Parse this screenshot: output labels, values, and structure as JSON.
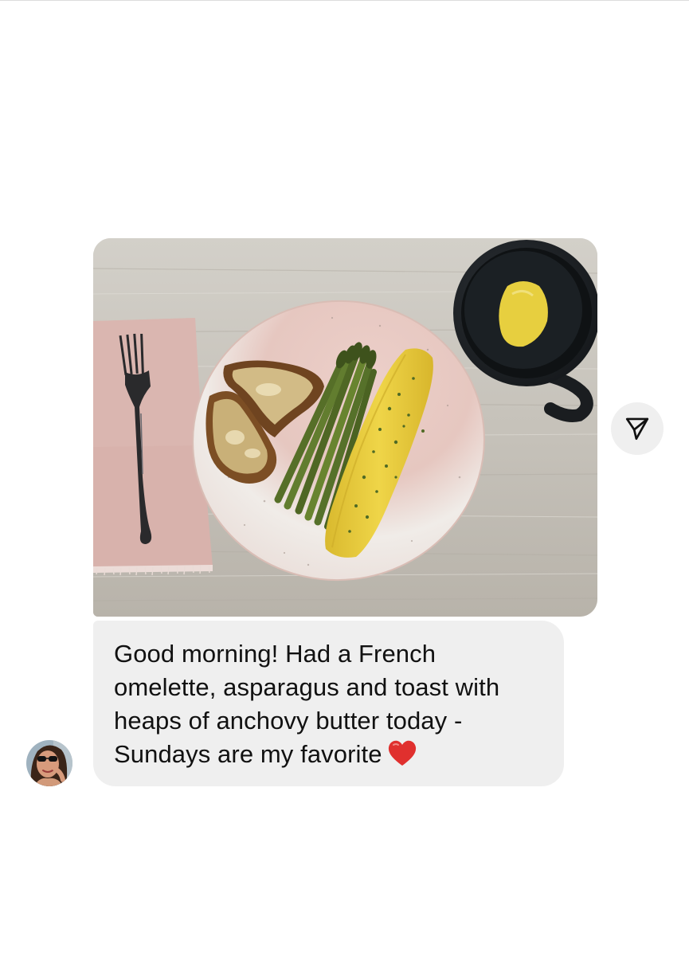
{
  "conversation": {
    "photo": {
      "alt": "Breakfast plate photo",
      "palette": {
        "table": "#c8c4bc",
        "napkin": "#d9b3ae",
        "plate_pink": "#e9c9c3",
        "plate_white": "#f1efec",
        "omelette": "#e5c93a",
        "asparagus": "#5f7a2e",
        "toast": "#8b5a2b",
        "mug": "#1f2327",
        "lemon": "#e8d34a"
      }
    },
    "share": {
      "icon": "send-icon"
    },
    "message": {
      "text": "Good morning! Had a French\nomelette, asparagus and toast with\nheaps of anchovy butter today -\nSundays are my favorite",
      "emoji_icon": "heart-icon",
      "emoji_color": "#e0302e"
    },
    "sender": {
      "avatar_icon": "avatar"
    }
  }
}
